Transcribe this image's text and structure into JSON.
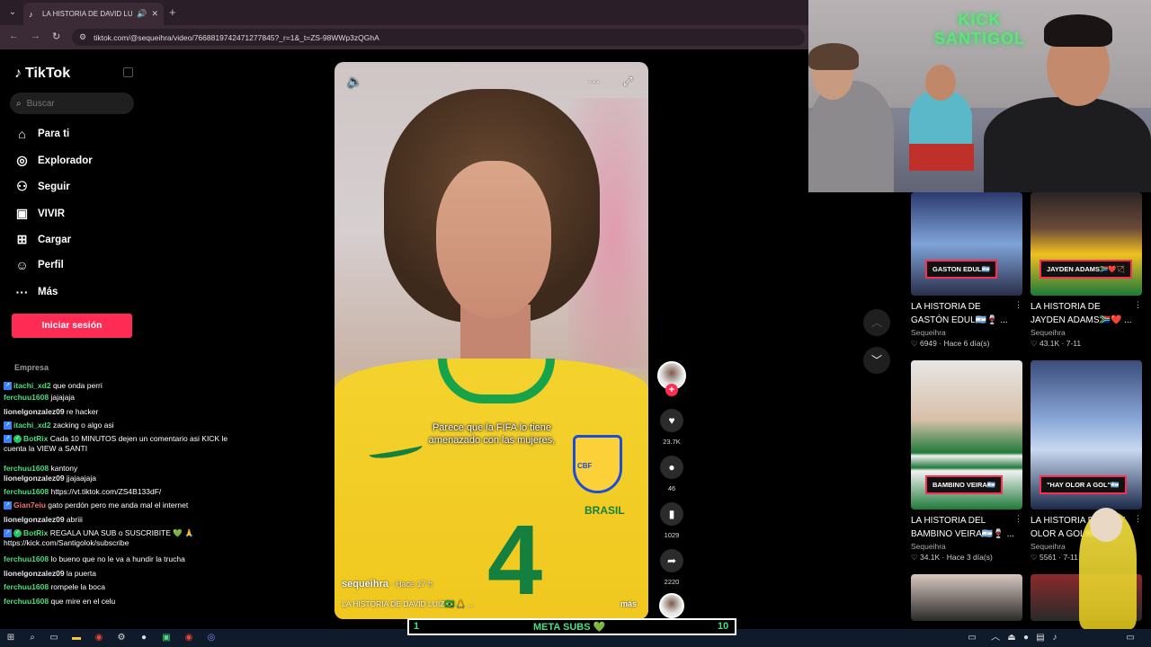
{
  "browser": {
    "tab_title": "LA HISTORIA DE DAVID LUI",
    "url": "tiktok.com/@sequeihra/video/7668819742471277845?_r=1&_t=ZS-98WWp3zQGhA",
    "new_tab": "+"
  },
  "sidebar": {
    "brand": "TikTok",
    "search_placeholder": "Buscar",
    "items": [
      {
        "label": "Para ti",
        "icon": "home-icon"
      },
      {
        "label": "Explorador",
        "icon": "compass-icon"
      },
      {
        "label": "Seguir",
        "icon": "follow-icon"
      },
      {
        "label": "VIVIR",
        "icon": "live-icon"
      },
      {
        "label": "Cargar",
        "icon": "upload-icon"
      },
      {
        "label": "Perfil",
        "icon": "profile-icon"
      },
      {
        "label": "Más",
        "icon": "more-icon"
      }
    ],
    "login": "Iniciar sesión",
    "empresa": "Empresa"
  },
  "chat": [
    {
      "user": "itachi_xd2",
      "msg": "que onda perri",
      "color": "#4ade80",
      "badge": "blue"
    },
    {
      "user": "ferchuu1608",
      "msg": "jajajaja",
      "color": "#4ade80",
      "badge": ""
    },
    {
      "user": "lionelgonzalez09",
      "msg": "re hacker",
      "color": "#e5e7eb",
      "badge": ""
    },
    {
      "user": "itachi_xd2",
      "msg": "zacking o algo asi",
      "color": "#4ade80",
      "badge": "blue"
    },
    {
      "user": "BotRix",
      "msg": "Cada 10 MINUTOS dejen un comentario asi KICK le cuenta la VIEW a SANTI",
      "color": "#4ade80",
      "badge": "bot"
    },
    {
      "user": "ferchuu1608",
      "msg": "kantony",
      "color": "#4ade80",
      "badge": ""
    },
    {
      "user": "lionelgonzalez09",
      "msg": "jjajaajaja",
      "color": "#e5e7eb",
      "badge": ""
    },
    {
      "user": "ferchuu1608",
      "msg": "https://vt.tiktok.com/ZS4B133dF/",
      "color": "#4ade80",
      "badge": ""
    },
    {
      "user": "Gian7eiu",
      "msg": "gato perdón pero me anda mal el internet",
      "color": "#f87171",
      "badge": "blue"
    },
    {
      "user": "lionelgonzalez09",
      "msg": "abriii",
      "color": "#e5e7eb",
      "badge": ""
    },
    {
      "user": "BotRix",
      "msg": "REGALA UNA SUB o SUSCRIBITE 💚 🙏 https://kick.com/Santigolok/subscribe",
      "color": "#4ade80",
      "badge": "bot"
    },
    {
      "user": "ferchuu1608",
      "msg": "lo bueno que no le va a hundir la trucha",
      "color": "#4ade80",
      "badge": ""
    },
    {
      "user": "lionelgonzalez09",
      "msg": "la puerta",
      "color": "#e5e7eb",
      "badge": ""
    },
    {
      "user": "ferchuu1608",
      "msg": "rompele la boca",
      "color": "#4ade80",
      "badge": ""
    },
    {
      "user": "ferchuu1608",
      "msg": "que mire en el celu",
      "color": "#4ade80",
      "badge": ""
    }
  ],
  "video": {
    "subtitle_1": "Parece que la FIFA lo tiene",
    "subtitle_2": "amenazado con las mujeres,",
    "author": "sequeihra",
    "time": " · Hace 17 h",
    "description": "LA HISTORIA DE DAVID LUIZ🇧🇷 🙏 ...",
    "more": "más",
    "crest": "CBF",
    "brand": "BRASIL",
    "number": "4"
  },
  "actions": {
    "likes": "23.7K",
    "comments": "46",
    "saves": "1029",
    "shares": "2220"
  },
  "webcam": {
    "logo_line1": "KICK",
    "logo_line2": "SANTIGOL"
  },
  "grid": [
    {
      "label": "GASTON EDUL🇦🇷",
      "title": "LA HISTORIA DE GASTÓN EDUL🇦🇷🍷 ...",
      "author": "Sequeihra",
      "meta": "♡ 6949 · Hace 6 día(s)"
    },
    {
      "label": "JAYDEN ADAMS🇿🇦❤️🏹",
      "title": "LA HISTORIA DE JAYDEN ADAMS🇿🇦❤️ ...",
      "author": "Sequeihra",
      "meta": "♡ 43.1K · 7-11"
    },
    {
      "label": "BAMBINO VEIRA🇦🇷",
      "title": "LA HISTORIA DEL BAMBINO VEIRA🇦🇷🍷 ...",
      "author": "Sequeihra",
      "meta": "♡ 34.1K · Hace 3 día(s)"
    },
    {
      "label": "\"HAY OLOR A GOL\"🇦🇷",
      "title": "LA HISTORIA DEL HAY OLOR A GOL🇦🇷🍷 ...",
      "author": "Sequeihra",
      "meta": "♡ 5561 · 7-11"
    }
  ],
  "meta_subs": {
    "left": "1",
    "center": "META SUBS 💚",
    "right": "10"
  }
}
